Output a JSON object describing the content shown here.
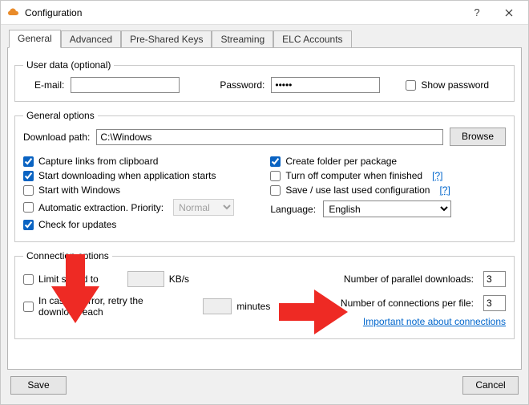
{
  "window": {
    "title": "Configuration"
  },
  "tabs": [
    {
      "label": "General"
    },
    {
      "label": "Advanced"
    },
    {
      "label": "Pre-Shared Keys"
    },
    {
      "label": "Streaming"
    },
    {
      "label": "ELC Accounts"
    }
  ],
  "user_data": {
    "legend": "User data (optional)",
    "email_label": "E-mail:",
    "email_value": "",
    "password_label": "Password:",
    "password_value": "•••••",
    "show_pw_label": "Show password",
    "show_pw_checked": false
  },
  "general_options": {
    "legend": "General options",
    "download_path_label": "Download path:",
    "download_path_value": "C:\\Windows",
    "browse_label": "Browse",
    "left": {
      "capture_label": "Capture links from clipboard",
      "capture_checked": true,
      "startdl_label": "Start downloading when application starts",
      "startdl_checked": true,
      "startwin_label": "Start with Windows",
      "startwin_checked": false,
      "autoex_label": "Automatic extraction. Priority:",
      "autoex_checked": false,
      "autoex_priority": "Normal",
      "chkupd_label": "Check for updates",
      "chkupd_checked": true
    },
    "right": {
      "createfolder_label": "Create folder per package",
      "createfolder_checked": true,
      "turnoff_label": "Turn off computer when finished",
      "turnoff_checked": false,
      "savecfg_label": "Save / use last used configuration",
      "savecfg_checked": false,
      "help": "[?]",
      "language_label": "Language:",
      "language_value": "English"
    }
  },
  "connection": {
    "legend": "Connection options",
    "limit_label": "Limit speed to",
    "limit_checked": false,
    "limit_value": "",
    "limit_unit": "KB/s",
    "retry_label": "In case of error, retry the download each",
    "retry_checked": false,
    "retry_value": "",
    "retry_unit": "minutes",
    "parallel_label": "Number of parallel downloads:",
    "parallel_value": "3",
    "conn_label": "Number of connections per file:",
    "conn_value": "3",
    "note_link": "Important note about connections"
  },
  "buttons": {
    "save": "Save",
    "cancel": "Cancel"
  }
}
